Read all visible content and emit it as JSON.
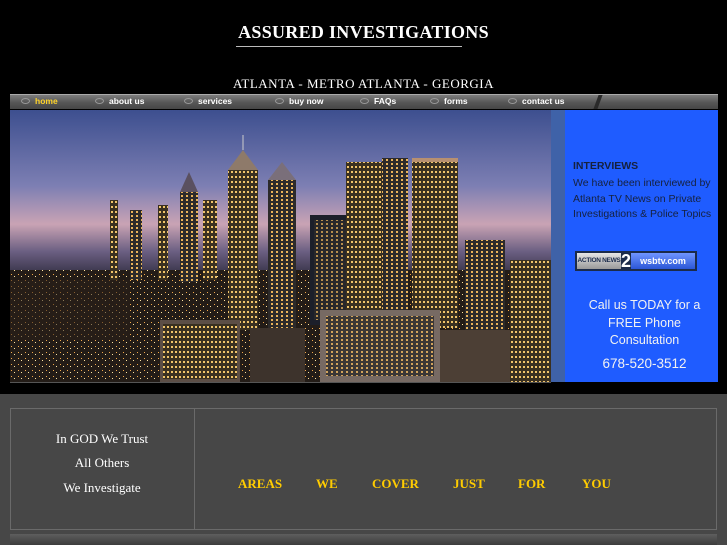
{
  "header": {
    "title": "ASSURED INVESTIGATIONS",
    "subtitle": "ATLANTA - METRO ATLANTA - GEORGIA"
  },
  "nav": {
    "items": [
      {
        "label": "home"
      },
      {
        "label": "about us"
      },
      {
        "label": "services"
      },
      {
        "label": "buy now"
      },
      {
        "label": "FAQs"
      },
      {
        "label": "forms"
      },
      {
        "label": "contact us"
      }
    ],
    "active_color": "#ffd42a"
  },
  "sidebar": {
    "heading": "INTERVIEWS",
    "body": "We have been interviewed by Atlanta TV News on Private Investigations & Police Topics",
    "news_logo": {
      "left": "ACTION NEWS",
      "number": "2",
      "right": "wsbtv.com"
    },
    "cta": "Call us TODAY for a FREE Phone Consultation",
    "phone": "678-520-3512",
    "panel_color": "#1f5cff"
  },
  "motto": {
    "line1": "In GOD We Trust",
    "line2": "All Others",
    "line3": "We Investigate"
  },
  "coverage": {
    "words": [
      "AREAS",
      "WE",
      "COVER",
      "JUST",
      "FOR",
      "YOU"
    ],
    "color": "#ffcc00"
  },
  "hero": {
    "icon": "atlanta-skyline-night-photo"
  }
}
